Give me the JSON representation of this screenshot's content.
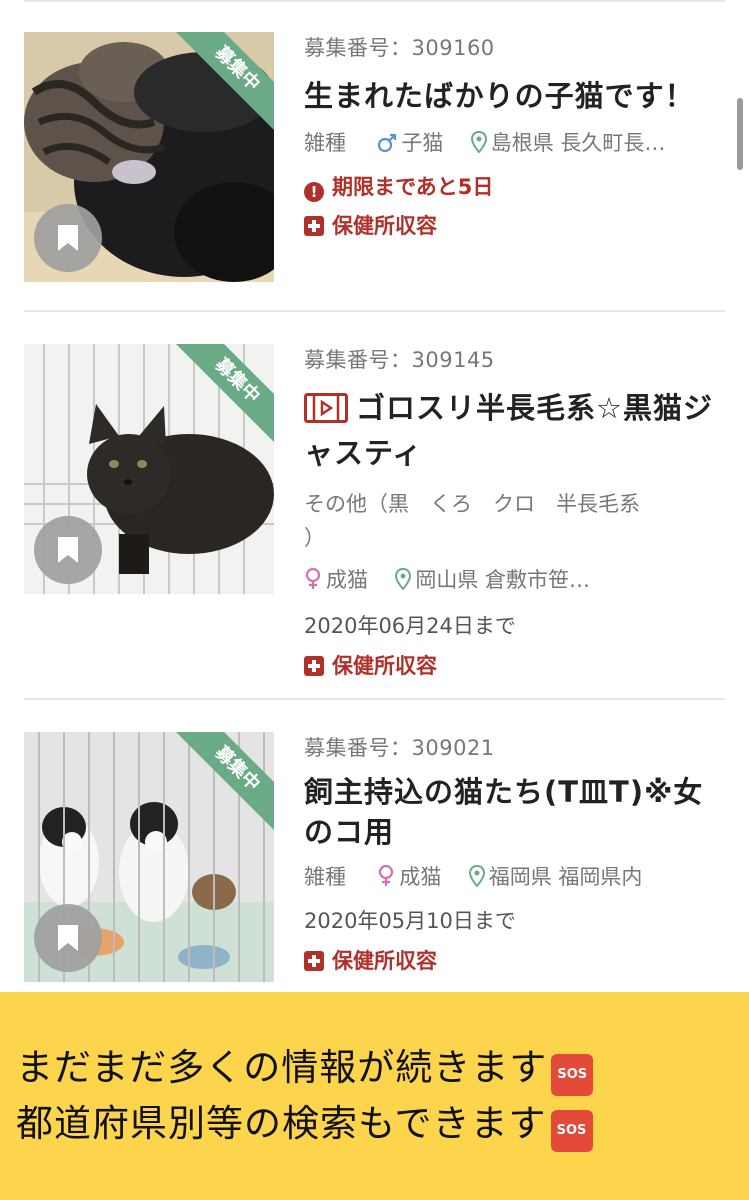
{
  "listings": [
    {
      "status": "募集中",
      "number": "募集番号：309160",
      "title": "生まれたばかりの子猫です！",
      "breed": "雑種",
      "age": "子猫",
      "location": "島根県 長久町長…",
      "alert": "期限まであと5日",
      "tag": "保健所収容"
    },
    {
      "status": "募集中",
      "number": "募集番号：309145",
      "title_line1": "ゴロスリ半長毛系☆黒猫ジ",
      "title_line2": "ャスティ",
      "breed_line1": "その他（黒　くろ　クロ　半長毛系",
      "breed_line2": "）",
      "age": "成猫",
      "location": "岡山県 倉敷市笹…",
      "deadline": "2020年06月24日まで",
      "tag": "保健所収容"
    },
    {
      "status": "募集中",
      "number": "募集番号：309021",
      "title_line1": "飼主持込の猫たち(T皿T)※女",
      "title_line2": "のコ用",
      "breed": "雑種",
      "age": "成猫",
      "location": "福岡県 福岡県内",
      "deadline": "2020年05月10日まで",
      "tag": "保健所収容"
    }
  ],
  "banner": {
    "line1": "まだまだ多くの情報が続きます",
    "line2": "都道府県別等の検索もできます",
    "sos": "SOS"
  },
  "colors": {
    "accent_red": "#b0312a",
    "ribbon_green": "#6aaa86",
    "male_blue": "#5b8fd6",
    "female_pink": "#d26fae",
    "banner_yellow": "#fdd54d"
  }
}
